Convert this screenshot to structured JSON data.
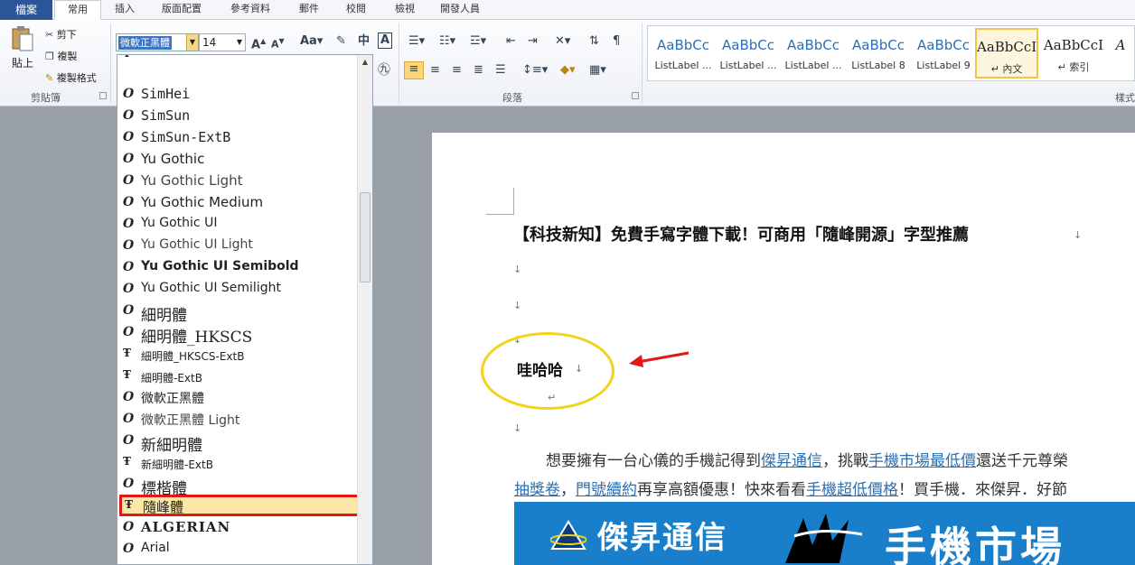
{
  "tabs": [
    "檔案",
    "常用",
    "插入",
    "版面配置",
    "參考資料",
    "郵件",
    "校閱",
    "檢視",
    "開發人員"
  ],
  "clipboard": {
    "paste": "貼上",
    "cut": "剪下",
    "copy": "複製",
    "format_painter": "複製格式",
    "group": "剪貼簿"
  },
  "font": {
    "name": "微軟正黑體",
    "size": "14"
  },
  "paragraph_group": "段落",
  "styles_group": "樣式",
  "styles": [
    {
      "sample": "AaBbCc",
      "name": "ListLabel ..."
    },
    {
      "sample": "AaBbCc",
      "name": "ListLabel ..."
    },
    {
      "sample": "AaBbCc",
      "name": "ListLabel ..."
    },
    {
      "sample": "AaBbCc",
      "name": "ListLabel 8"
    },
    {
      "sample": "AaBbCc",
      "name": "ListLabel 9"
    },
    {
      "sample": "AaBbCcI",
      "name": "↵ 內文"
    },
    {
      "sample": "AaBbCcI",
      "name": "↵ 索引"
    }
  ],
  "font_list": [
    {
      "name": "SimHei",
      "icon": "O"
    },
    {
      "name": "SimSun",
      "icon": "O"
    },
    {
      "name": "SimSun-ExtB",
      "icon": "O"
    },
    {
      "name": "Yu Gothic",
      "icon": "O"
    },
    {
      "name": "Yu Gothic Light",
      "icon": "O"
    },
    {
      "name": "Yu Gothic Medium",
      "icon": "O"
    },
    {
      "name": "Yu Gothic UI",
      "icon": "O"
    },
    {
      "name": "Yu Gothic UI Light",
      "icon": "O"
    },
    {
      "name": "Yu Gothic UI Semibold",
      "icon": "O"
    },
    {
      "name": "Yu Gothic UI Semilight",
      "icon": "O"
    },
    {
      "name": "細明體",
      "icon": "O"
    },
    {
      "name": "細明體_HKSCS",
      "icon": "O"
    },
    {
      "name": "細明體_HKSCS-ExtB",
      "icon": "T"
    },
    {
      "name": "細明體-ExtB",
      "icon": "T"
    },
    {
      "name": "微軟正黑體",
      "icon": "O"
    },
    {
      "name": "微軟正黑體 Light",
      "icon": "O"
    },
    {
      "name": "新細明體",
      "icon": "O"
    },
    {
      "name": "新細明體-ExtB",
      "icon": "T"
    },
    {
      "name": "標楷體",
      "icon": "O"
    },
    {
      "name": "隨峰體",
      "icon": "T"
    },
    {
      "name": "ALGERIAN",
      "icon": "O"
    },
    {
      "name": "Arial",
      "icon": "O"
    }
  ],
  "document": {
    "title": "【科技新知】免費手寫字體下載！可商用「隨峰開源」字型推薦",
    "sample": "哇哈哈",
    "para_mark": "↓",
    "return_mark": "↵",
    "body1_pre": "想要擁有一台心儀的手機記得到",
    "body1_link1": "傑昇通信",
    "body1_mid": "，挑戰",
    "body1_link2": "手機市場最低價",
    "body1_post": "還送千元尊榮",
    "body2_link1": "抽獎卷",
    "body2_sep": "，",
    "body2_link2": "門號續約",
    "body2_mid": "再享高額優惠！快來看看",
    "body2_link3": "手機超低價格",
    "body2_post": "！買手機．來傑昇．好節",
    "banner_name": "傑昇通信",
    "banner_market": "手機市場"
  }
}
